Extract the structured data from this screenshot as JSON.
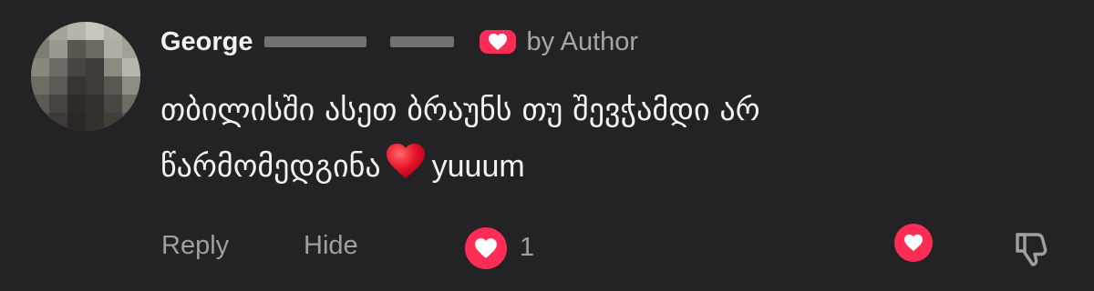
{
  "comment": {
    "author": {
      "name": "George"
    },
    "author_badge": {
      "icon": "heart-icon",
      "label": "by Author",
      "color": "#ff2d55"
    },
    "text_line_1": "თბილისში ასეთ ბრაუნს თუ შევჭამდი არ",
    "text_line_2": "წარმომედგინა",
    "text_emoji": "red-heart-emoji",
    "text_tail": "yuuum",
    "actions": {
      "reply_label": "Reply",
      "hide_label": "Hide",
      "like_icon": "heart-icon",
      "like_count": "1",
      "creator_heart_icon": "heart-icon",
      "dislike_icon": "thumbs-down-icon"
    }
  },
  "colors": {
    "background": "#232224",
    "text": "#f2f2f2",
    "muted": "#a0a0a0",
    "accent": "#ff2d55"
  }
}
